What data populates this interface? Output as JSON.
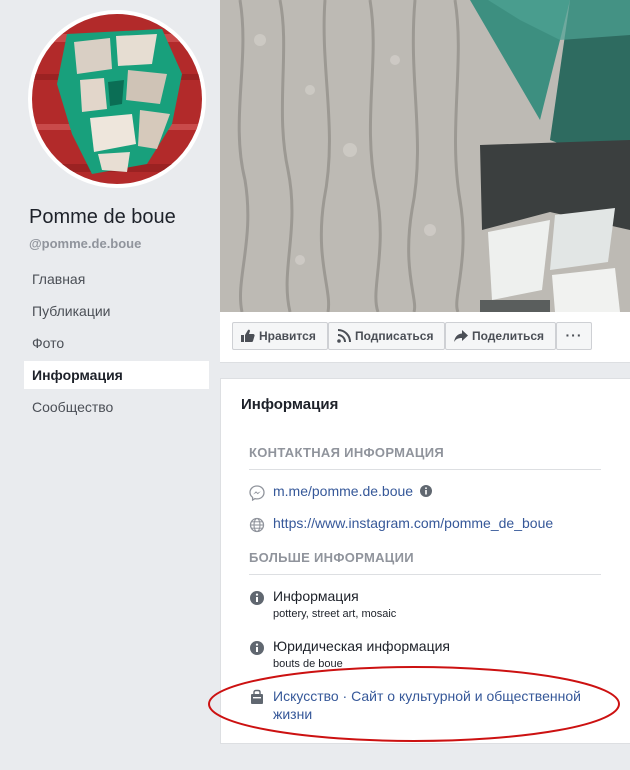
{
  "page": {
    "name": "Pomme de boue",
    "handle": "@pomme.de.boue"
  },
  "nav": {
    "items": [
      {
        "label": "Главная"
      },
      {
        "label": "Публикации"
      },
      {
        "label": "Фото"
      },
      {
        "label": "Информация"
      },
      {
        "label": "Сообщество"
      }
    ],
    "active_index": 3
  },
  "actions": {
    "like": "Нравится",
    "follow": "Подписаться",
    "share": "Поделиться",
    "more": "···"
  },
  "about": {
    "title": "Информация",
    "contact_heading": "КОНТАКТНАЯ ИНФОРМАЦИЯ",
    "messenger": "m.me/pomme.de.boue",
    "website": "https://www.instagram.com/pomme_de_boue",
    "more_heading": "БОЛЬШЕ ИНФОРМАЦИИ",
    "info_label": "Информация",
    "info_value": "pottery, street art, mosaic",
    "legal_label": "Юридическая информация",
    "legal_value": "bouts de boue",
    "category_line1": "Искусство · Сайт о культурной и общественной",
    "category_line2": "жизни"
  },
  "icons": {
    "like": "thumbs-up-icon",
    "follow": "rss-icon",
    "share": "share-arrow-icon",
    "messenger": "messenger-icon",
    "website": "globe-icon",
    "info": "info-icon",
    "category": "category-icon"
  },
  "colors": {
    "link": "#365899",
    "annotation": "#cc1111",
    "background": "#e9ebee"
  }
}
